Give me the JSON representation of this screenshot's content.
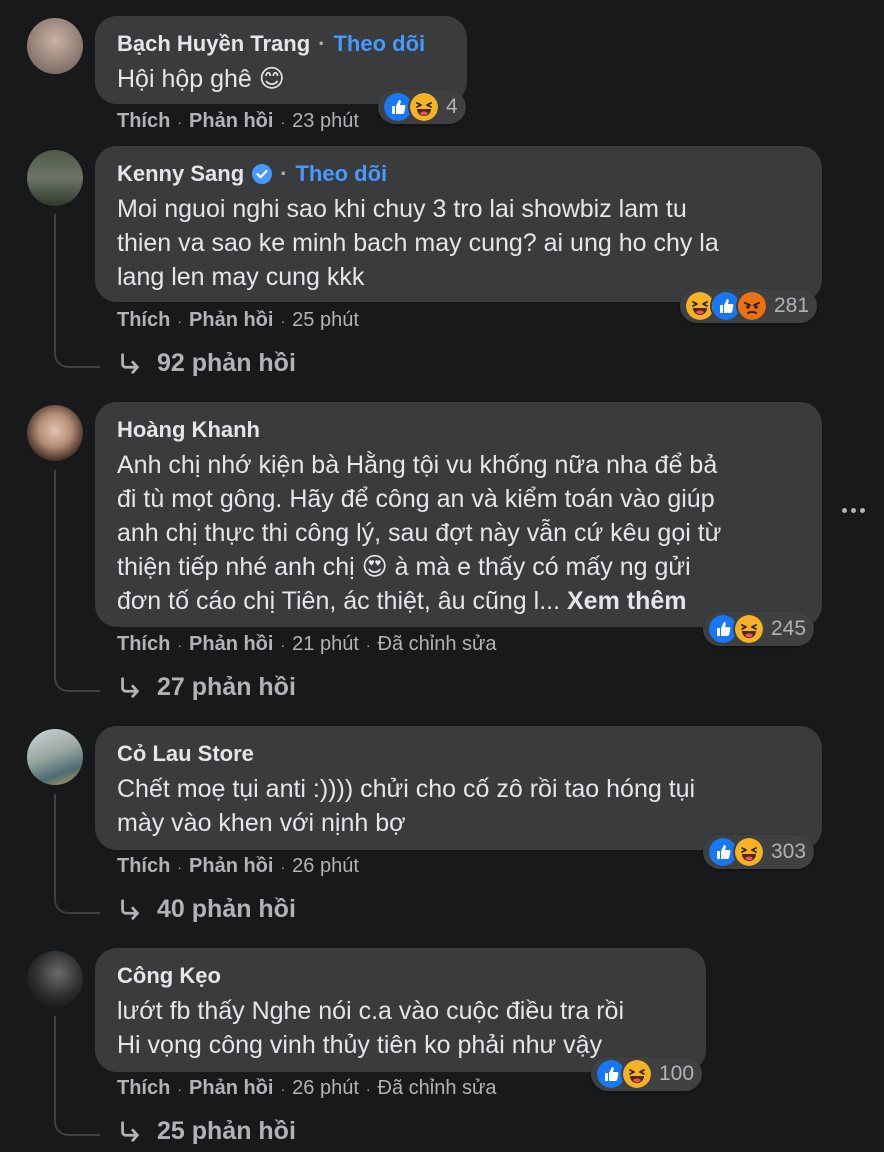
{
  "comments": [
    {
      "name": "Bạch Huyền Trang",
      "follow": "Theo dõi",
      "text": "Hội hộp ghê 😊",
      "like": "Thích",
      "reply": "Phản hồi",
      "time": "23 phút",
      "edited": "",
      "reaction_count": "4",
      "reactions": [
        "like-icon",
        "haha-icon"
      ],
      "replies": ""
    },
    {
      "name": "Kenny Sang",
      "follow": "Theo dõi",
      "verified": true,
      "text": "Moi nguoi nghi sao khi chuy 3 tro lai showbiz lam tu\nthien va sao ke minh bach may cung? ai ung ho chy la\nlang len may cung kkk",
      "like": "Thích",
      "reply": "Phản hồi",
      "time": "25 phút",
      "edited": "",
      "reaction_count": "281",
      "reactions": [
        "haha-icon",
        "like-icon",
        "angry-icon"
      ],
      "replies": "92 phản hồi"
    },
    {
      "name": "Hoàng Khanh",
      "text": "Anh chị nhớ kiện bà Hằng tội vu khống nữa nha để bả\nđi tù mọt gông. Hãy để công an và kiểm toán vào giúp\nanh chị thực thi công lý, sau đợt này vẫn cứ kêu gọi từ\nthiện tiếp nhé anh chị 😍 à mà e thấy có mấy ng gửi\nđơn tố cáo chị Tiên, ác thiệt, âu cũng l...",
      "see_more": "Xem thêm",
      "like": "Thích",
      "reply": "Phản hồi",
      "time": "21 phút",
      "edited": "Đã chỉnh sửa",
      "reaction_count": "245",
      "reactions": [
        "like-icon",
        "haha-icon"
      ],
      "replies": "27 phản hồi"
    },
    {
      "name": "Cỏ Lau Store",
      "text": "Chết moẹ tụi anti :)))) chửi cho cố zô rồi tao hóng tụi\nmày vào khen với nịnh bợ",
      "like": "Thích",
      "reply": "Phản hồi",
      "time": "26 phút",
      "edited": "",
      "reaction_count": "303",
      "reactions": [
        "like-icon",
        "haha-icon"
      ],
      "replies": "40 phản hồi"
    },
    {
      "name": "Công Kẹo",
      "text": "lướt fb thấy Nghe nói c.a vào cuộc điều tra rồi\nHi vọng công vinh thủy tiên ko phải như vậy",
      "like": "Thích",
      "reply": "Phản hồi",
      "time": "26 phút",
      "edited": "Đã chỉnh sửa",
      "reaction_count": "100",
      "reactions": [
        "like-icon",
        "haha-icon"
      ],
      "replies": "25 phản hồi"
    }
  ],
  "more_menu_icon": "more-horizontal-icon",
  "colors": {
    "background": "#18191a",
    "bubble": "#3a3b3c",
    "follow": "#4599ff",
    "secondary_text": "#b0b3b8",
    "like": "#1877f2",
    "haha": "#f7b125",
    "angry": "#e9710f"
  }
}
